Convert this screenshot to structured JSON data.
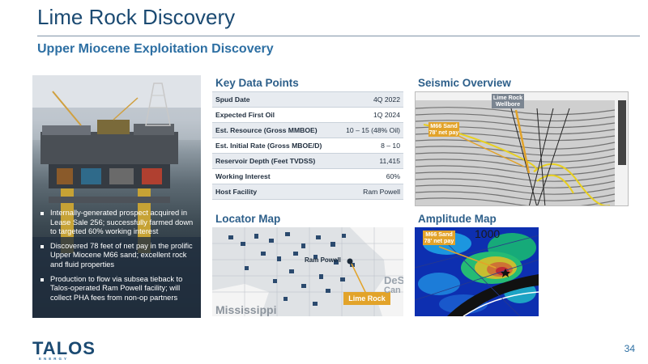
{
  "header": {
    "title": "Lime Rock Discovery",
    "subtitle": "Upper Miocene Exploitation Discovery"
  },
  "left_panel": {
    "bullets": [
      "Internally-generated prospect acquired in Lease Sale 256; successfully farmed down to targeted 60% working interest",
      "Discovered 78 feet of net pay in the prolific Upper Miocene M66 sand; excellent rock and fluid properties",
      "Production to flow via subsea tieback to Talos-operated Ram Powell facility; will collect PHA fees from non-op partners"
    ]
  },
  "key_data": {
    "heading": "Key Data Points",
    "rows": [
      {
        "label": "Spud Date",
        "value": "4Q 2022"
      },
      {
        "label": "Expected First Oil",
        "value": "1Q 2024"
      },
      {
        "label": "Est. Resource (Gross MMBOE)",
        "value": "10 – 15 (48% Oil)"
      },
      {
        "label": "Est. Initial Rate (Gross MBOE/D)",
        "value": "8 – 10"
      },
      {
        "label": "Reservoir Depth (Feet TVDSS)",
        "value": "11,415"
      },
      {
        "label": "Working Interest",
        "value": "60%"
      },
      {
        "label": "Host Facility",
        "value": "Ram Powell"
      }
    ]
  },
  "seismic": {
    "heading": "Seismic Overview",
    "wellbore_label": "Lime Rock Wellbore",
    "sand_label": "M66 Sand 78' net pay"
  },
  "locator": {
    "heading": "Locator Map",
    "ram_powell": "Ram Powell",
    "lime_rock": "Lime Rock",
    "state_label": "Mississippi",
    "desoto": "DeS",
    "desoto_line2": "Can"
  },
  "amplitude": {
    "heading": "Amplitude Map",
    "sand_label": "M66 Sand 78' net pay",
    "contour_label": "1000"
  },
  "footer": {
    "logo": "TALOS",
    "logo_sub": "ENERGY",
    "page_number": "34"
  },
  "colors": {
    "title": "#1b4a72",
    "accent": "#2d6fa3",
    "gold": "#e2a32a"
  }
}
